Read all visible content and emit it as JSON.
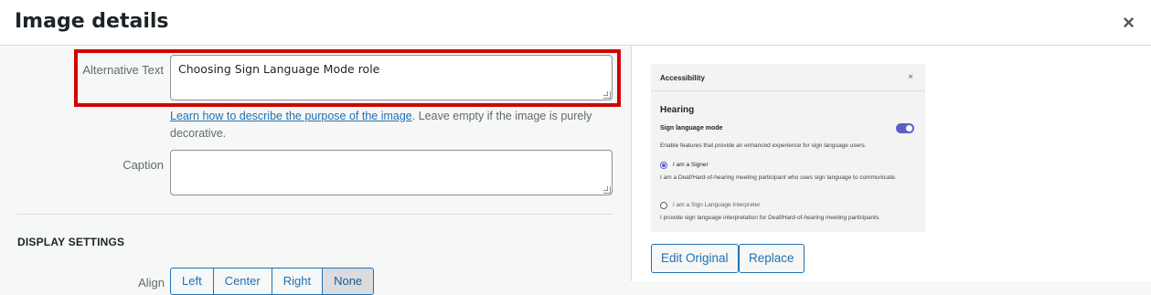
{
  "modal": {
    "title": "Image details",
    "close_icon": "×"
  },
  "fields": {
    "alt_label": "Alternative Text",
    "alt_value": "Choosing Sign Language Mode role",
    "help_link": "Learn how to describe the purpose of the image",
    "help_rest": ". Leave empty if the image is purely decorative.",
    "caption_label": "Caption",
    "caption_value": ""
  },
  "display_settings": {
    "heading": "DISPLAY SETTINGS",
    "align_label": "Align",
    "align_options": [
      "Left",
      "Center",
      "Right",
      "None"
    ],
    "align_selected": "None"
  },
  "preview": {
    "panel_title": "Accessibility",
    "close_icon": "×",
    "section": "Hearing",
    "sign_mode_label": "Sign language mode",
    "sign_mode_on": true,
    "sign_mode_desc": "Enable features that provide an enhanced experience for sign language users.",
    "option1": "I am a Signer",
    "option1_desc": "I am a Deaf/Hard-of-hearing meeting participant who uses sign language to communicate.",
    "option2": "I am a Sign Language Interpreter",
    "option2_desc": "I provide sign language interpretation for Deaf/Hard-of-hearing meeting participants."
  },
  "actions": {
    "edit_original": "Edit Original",
    "replace": "Replace"
  },
  "colors": {
    "accent": "#2271b1",
    "highlight": "#d40000",
    "toggle": "#5b5fc7"
  }
}
